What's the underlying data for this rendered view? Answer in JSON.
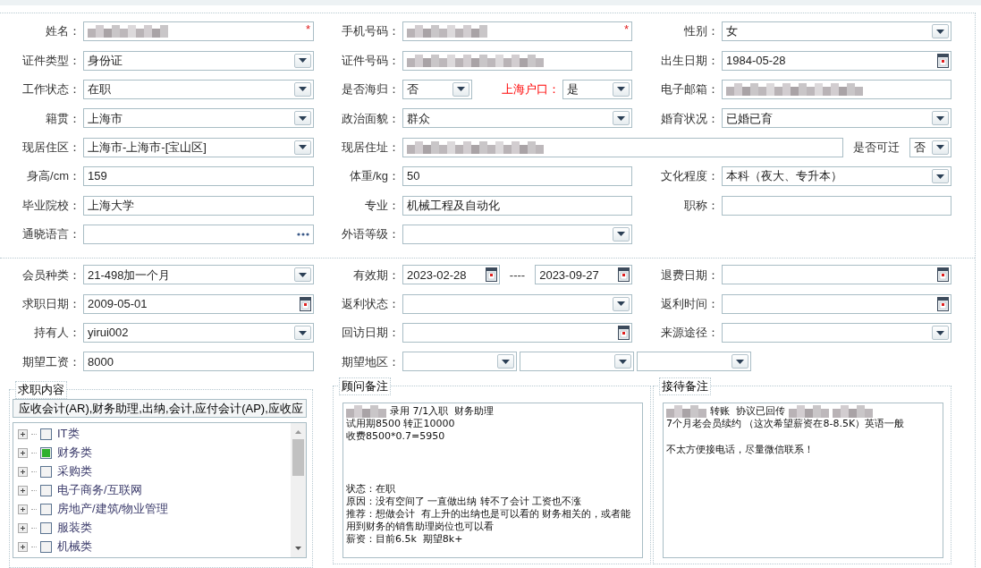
{
  "personal_rows": [
    {
      "items": [
        {
          "label": "姓名：",
          "controls": [
            {
              "kind": "text",
              "redacted": true,
              "required_mark": "*"
            }
          ]
        },
        {
          "label": "手机号码：",
          "controls": [
            {
              "kind": "text",
              "redacted": true,
              "required_mark": "*"
            }
          ]
        },
        {
          "label": "性别：",
          "controls": [
            {
              "kind": "select",
              "value": "女"
            }
          ]
        }
      ]
    },
    {
      "items": [
        {
          "label": "证件类型：",
          "controls": [
            {
              "kind": "select",
              "value": "身份证"
            }
          ]
        },
        {
          "label": "证件号码：",
          "controls": [
            {
              "kind": "text",
              "redacted": true
            }
          ]
        },
        {
          "label": "出生日期：",
          "controls": [
            {
              "kind": "date",
              "value": "1984-05-28"
            }
          ]
        }
      ]
    },
    {
      "items": [
        {
          "label": "工作状态：",
          "controls": [
            {
              "kind": "select",
              "value": "在职"
            }
          ]
        },
        {
          "label": "是否海归：",
          "controls": [
            {
              "kind": "select",
              "value": "否"
            },
            {
              "kind": "label",
              "text": "上海户口：",
              "emphasis": true
            },
            {
              "kind": "select",
              "value": "是"
            }
          ]
        },
        {
          "label": "电子邮箱：",
          "controls": [
            {
              "kind": "text",
              "redacted": true
            }
          ]
        }
      ]
    },
    {
      "items": [
        {
          "label": "籍贯：",
          "controls": [
            {
              "kind": "select",
              "value": "上海市"
            }
          ]
        },
        {
          "label": "政治面貌：",
          "controls": [
            {
              "kind": "select",
              "value": "群众"
            }
          ]
        },
        {
          "label": "婚育状况：",
          "controls": [
            {
              "kind": "select",
              "value": "已婚已育"
            }
          ]
        }
      ]
    },
    {
      "items": [
        {
          "label": "现居住区：",
          "controls": [
            {
              "kind": "select",
              "value": "上海市-上海市-[宝山区]"
            }
          ]
        },
        {
          "label": "现居住址：",
          "controls": [
            {
              "kind": "text",
              "redacted": true
            },
            {
              "kind": "label",
              "text": "是否可迁",
              "emphasis": false
            },
            {
              "kind": "select",
              "value": "否"
            }
          ]
        }
      ]
    },
    {
      "items": [
        {
          "label": "身高/cm：",
          "controls": [
            {
              "kind": "text",
              "value": "159"
            }
          ]
        },
        {
          "label": "体重/kg：",
          "controls": [
            {
              "kind": "text",
              "value": "50"
            }
          ]
        },
        {
          "label": "文化程度：",
          "controls": [
            {
              "kind": "select",
              "value": "本科（夜大、专升本）"
            }
          ]
        }
      ]
    },
    {
      "items": [
        {
          "label": "毕业院校：",
          "controls": [
            {
              "kind": "text",
              "value": "上海大学"
            }
          ]
        },
        {
          "label": "专业：",
          "controls": [
            {
              "kind": "text",
              "value": "机械工程及自动化"
            }
          ]
        },
        {
          "label": "职称：",
          "controls": [
            {
              "kind": "text"
            }
          ]
        }
      ]
    },
    {
      "items": [
        {
          "label": "通晓语言：",
          "controls": [
            {
              "kind": "lookup"
            }
          ]
        },
        {
          "label": "外语等级：",
          "controls": [
            {
              "kind": "select"
            }
          ]
        }
      ]
    }
  ],
  "membership_rows": [
    {
      "items": [
        {
          "label": "会员种类：",
          "controls": [
            {
              "kind": "select",
              "value": "21-498加一个月"
            }
          ]
        },
        {
          "label": "有效期：",
          "controls": [
            {
              "kind": "date",
              "value": "2023-02-28"
            },
            {
              "kind": "separator",
              "text": "----"
            },
            {
              "kind": "date",
              "value": "2023-09-27"
            }
          ]
        },
        {
          "label": "退费日期：",
          "controls": [
            {
              "kind": "date"
            }
          ]
        }
      ]
    },
    {
      "items": [
        {
          "label": "求职日期：",
          "controls": [
            {
              "kind": "date",
              "value": "2009-05-01"
            }
          ]
        },
        {
          "label": "返利状态：",
          "controls": [
            {
              "kind": "select"
            }
          ]
        },
        {
          "label": "返利时间：",
          "controls": [
            {
              "kind": "date"
            }
          ]
        }
      ]
    },
    {
      "items": [
        {
          "label": "持有人：",
          "controls": [
            {
              "kind": "select",
              "value": "yirui002"
            }
          ]
        },
        {
          "label": "回访日期：",
          "controls": [
            {
              "kind": "date"
            }
          ]
        },
        {
          "label": "来源途径：",
          "controls": [
            {
              "kind": "select"
            }
          ]
        }
      ]
    },
    {
      "items": [
        {
          "label": "期望工资：",
          "controls": [
            {
              "kind": "text",
              "value": "8000"
            }
          ]
        },
        {
          "label": "期望地区：",
          "controls": [
            {
              "kind": "select"
            },
            {
              "kind": "select"
            },
            {
              "kind": "select"
            }
          ]
        }
      ]
    }
  ],
  "job_intent": {
    "title": "求职内容",
    "summary": "应收会计(AR),财务助理,出纳,会计,应付会计(AP),应收应",
    "categories": [
      {
        "label": "IT类",
        "checked": false,
        "expanded": false
      },
      {
        "label": "财务类",
        "checked": true,
        "expanded": false
      },
      {
        "label": "采购类",
        "checked": false,
        "expanded": false
      },
      {
        "label": "电子商务/互联网",
        "checked": false,
        "expanded": false
      },
      {
        "label": "房地产/建筑/物业管理",
        "checked": false,
        "expanded": false
      },
      {
        "label": "服装类",
        "checked": false,
        "expanded": false
      },
      {
        "label": "机械类",
        "checked": false,
        "expanded": false
      }
    ]
  },
  "notes": [
    {
      "title": "顾问备注",
      "lines": [
        {
          "kind": "text",
          "parts": [
            {
              "kind": "redacted"
            },
            {
              "kind": "text",
              "text": "录用 7/1入职  财务助理"
            }
          ]
        },
        {
          "kind": "text",
          "parts": [
            {
              "kind": "text",
              "text": "试用期8500 转正10000"
            }
          ]
        },
        {
          "kind": "text",
          "parts": [
            {
              "kind": "text",
              "text": "收费8500*0.7=5950"
            }
          ]
        },
        {
          "kind": "blank"
        },
        {
          "kind": "blank"
        },
        {
          "kind": "blank"
        },
        {
          "kind": "text",
          "parts": [
            {
              "kind": "text",
              "text": "状态：在职"
            }
          ]
        },
        {
          "kind": "text",
          "parts": [
            {
              "kind": "text",
              "text": "原因：没有空间了 一直做出纳 转不了会计 工资也不涨"
            }
          ]
        },
        {
          "kind": "text",
          "parts": [
            {
              "kind": "text",
              "text": "推荐：想做会计  有上升的出纳也是可以看的 财务相关的，或者能用到财务的销售助理岗位也可以看"
            }
          ]
        },
        {
          "kind": "text",
          "parts": [
            {
              "kind": "text",
              "text": "薪资：目前6.5k  期望8k+"
            }
          ]
        }
      ]
    },
    {
      "title": "接待备注",
      "lines": [
        {
          "kind": "text",
          "parts": [
            {
              "kind": "redacted"
            },
            {
              "kind": "text",
              "text": "转账  协议已回传"
            },
            {
              "kind": "redacted"
            },
            {
              "kind": "redacted"
            }
          ]
        },
        {
          "kind": "text",
          "parts": [
            {
              "kind": "text",
              "text": "7个月老会员续约 （这次希望薪资在8-8.5K）英语一般"
            }
          ]
        },
        {
          "kind": "blank"
        },
        {
          "kind": "text",
          "parts": [
            {
              "kind": "text",
              "text": "不太方便接电话，尽量微信联系！"
            }
          ]
        }
      ]
    }
  ]
}
